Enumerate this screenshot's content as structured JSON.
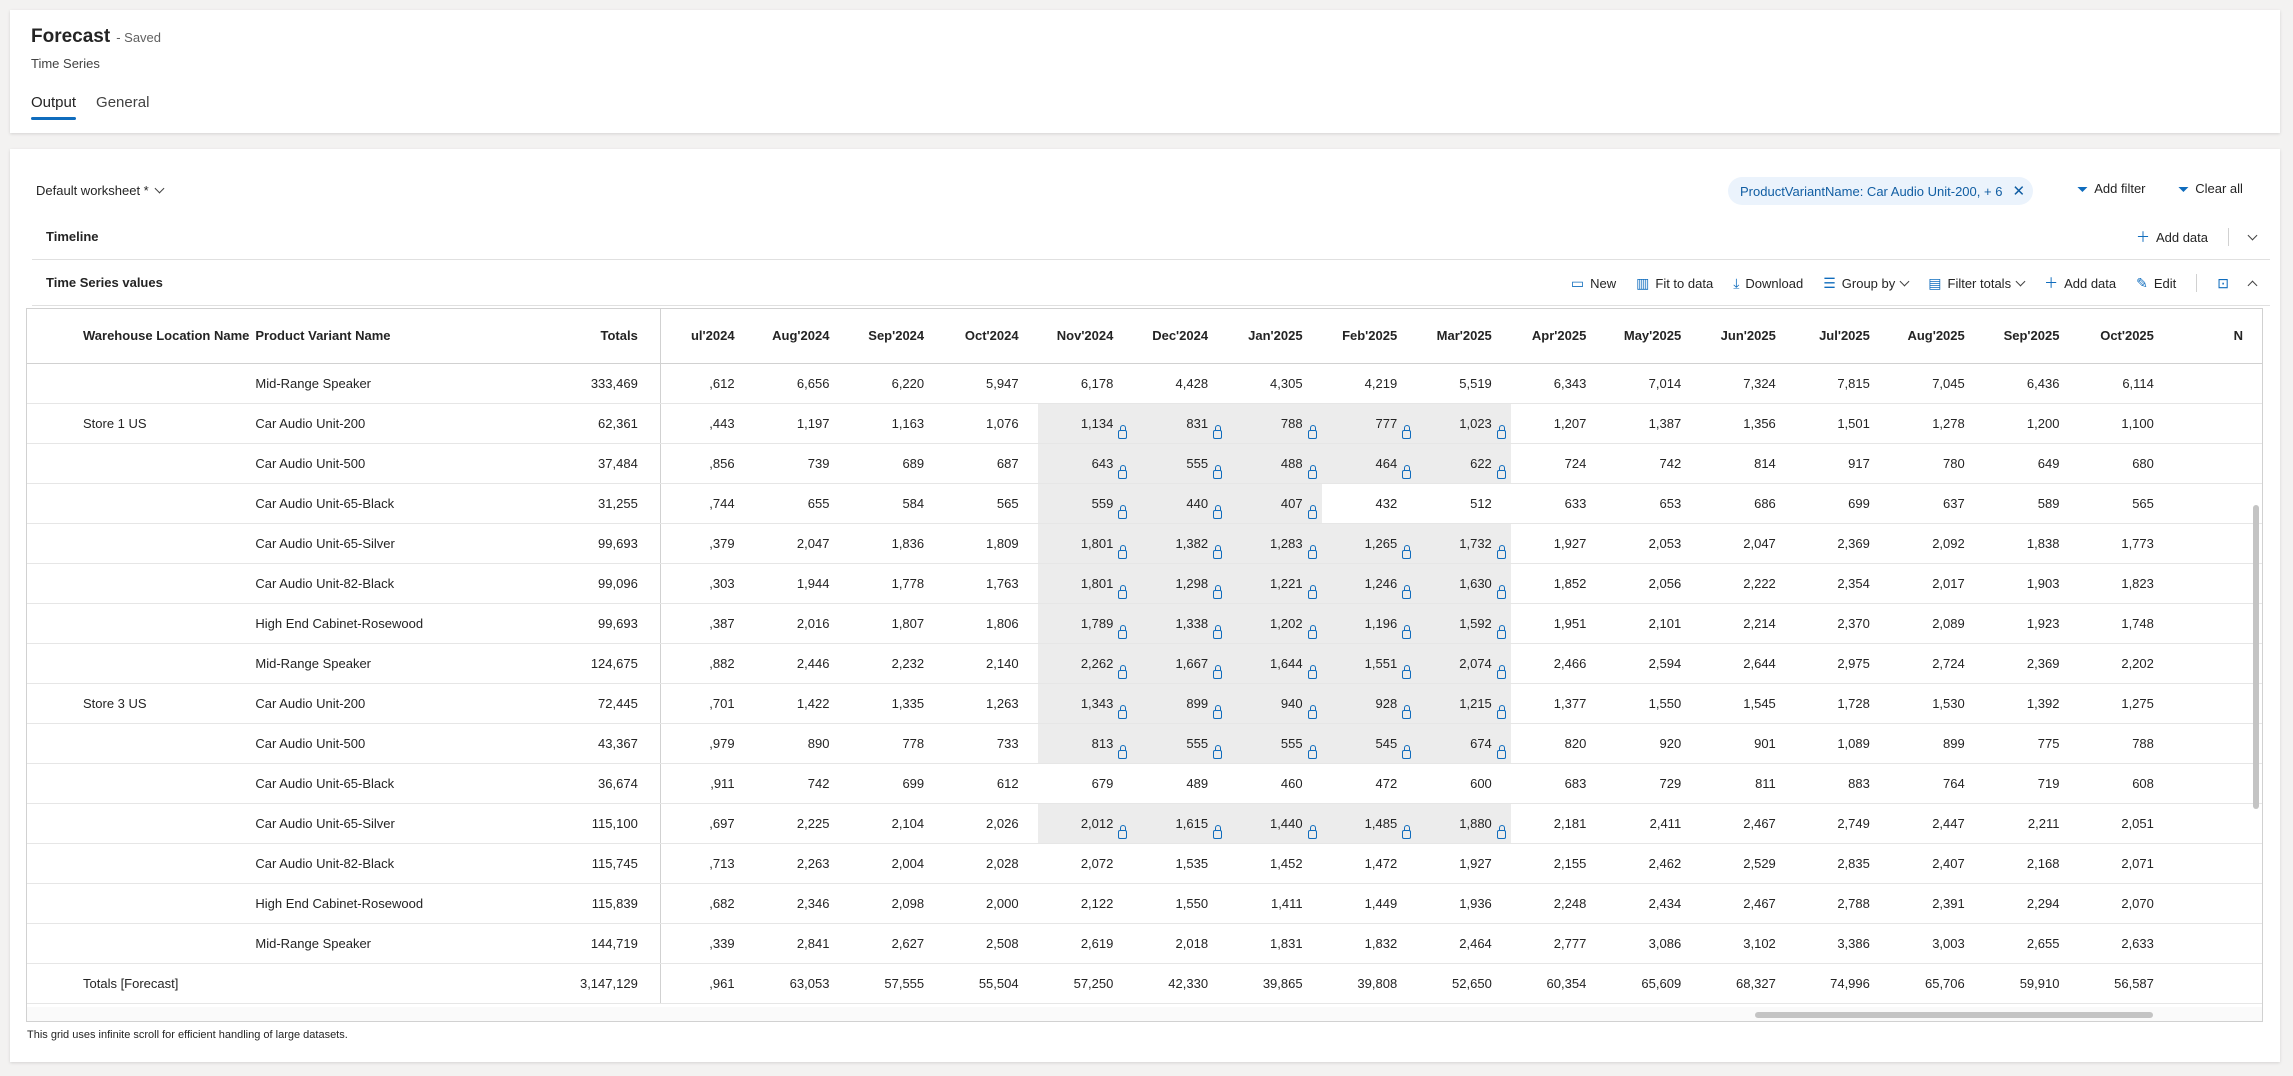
{
  "header": {
    "title": "Forecast",
    "saved": "- Saved",
    "subtitle": "Time Series"
  },
  "tabs": [
    {
      "label": "Output"
    },
    {
      "label": "General"
    }
  ],
  "worksheet": {
    "label": "Default worksheet *"
  },
  "filter_chip": {
    "label": "ProductVariantName: Car Audio Unit-200, + 6"
  },
  "actions": {
    "add_filter": "Add filter",
    "clear_all": "Clear all"
  },
  "timeline": {
    "title": "Timeline",
    "add_data": "Add data"
  },
  "tsv": {
    "title": "Time Series values",
    "toolbar": {
      "new": "New",
      "fit": "Fit to data",
      "download": "Download",
      "group_by": "Group by",
      "filter_totals": "Filter totals",
      "add_data": "Add data",
      "edit": "Edit"
    }
  },
  "grid": {
    "columns": {
      "warehouse": "Warehouse Location Name",
      "product": "Product Variant Name",
      "totals": "Totals"
    },
    "months": [
      "ul'2024",
      "Aug'2024",
      "Sep'2024",
      "Oct'2024",
      "Nov'2024",
      "Dec'2024",
      "Jan'2025",
      "Feb'2025",
      "Mar'2025",
      "Apr'2025",
      "May'2025",
      "Jun'2025",
      "Jul'2025",
      "Aug'2025",
      "Sep'2025",
      "Oct'2025",
      "N"
    ],
    "rows": [
      {
        "warehouse": "",
        "product": "Mid-Range Speaker",
        "total": "333,469",
        "values": [
          ",612",
          "6,656",
          "6,220",
          "5,947",
          "6,178",
          "4,428",
          "4,305",
          "4,219",
          "5,519",
          "6,343",
          "7,014",
          "7,324",
          "7,815",
          "7,045",
          "6,436",
          "6,114",
          ""
        ]
      },
      {
        "warehouse": "Store 1 US",
        "product": "Car Audio Unit-200",
        "total": "62,361",
        "values": [
          ",443",
          "1,197",
          "1,163",
          "1,076",
          "1,134",
          "831",
          "788",
          "777",
          "1,023",
          "1,207",
          "1,387",
          "1,356",
          "1,501",
          "1,278",
          "1,200",
          "1,100",
          ""
        ]
      },
      {
        "warehouse": "",
        "product": "Car Audio Unit-500",
        "total": "37,484",
        "values": [
          ",856",
          "739",
          "689",
          "687",
          "643",
          "555",
          "488",
          "464",
          "622",
          "724",
          "742",
          "814",
          "917",
          "780",
          "649",
          "680",
          ""
        ]
      },
      {
        "warehouse": "",
        "product": "Car Audio Unit-65-Black",
        "total": "31,255",
        "values": [
          ",744",
          "655",
          "584",
          "565",
          "559",
          "440",
          "407",
          "432",
          "512",
          "633",
          "653",
          "686",
          "699",
          "637",
          "589",
          "565",
          ""
        ]
      },
      {
        "warehouse": "",
        "product": "Car Audio Unit-65-Silver",
        "total": "99,693",
        "values": [
          ",379",
          "2,047",
          "1,836",
          "1,809",
          "1,801",
          "1,382",
          "1,283",
          "1,265",
          "1,732",
          "1,927",
          "2,053",
          "2,047",
          "2,369",
          "2,092",
          "1,838",
          "1,773",
          ""
        ]
      },
      {
        "warehouse": "",
        "product": "Car Audio Unit-82-Black",
        "total": "99,096",
        "values": [
          ",303",
          "1,944",
          "1,778",
          "1,763",
          "1,801",
          "1,298",
          "1,221",
          "1,246",
          "1,630",
          "1,852",
          "2,056",
          "2,222",
          "2,354",
          "2,017",
          "1,903",
          "1,823",
          ""
        ]
      },
      {
        "warehouse": "",
        "product": "High End Cabinet-Rosewood",
        "total": "99,693",
        "values": [
          ",387",
          "2,016",
          "1,807",
          "1,806",
          "1,789",
          "1,338",
          "1,202",
          "1,196",
          "1,592",
          "1,951",
          "2,101",
          "2,214",
          "2,370",
          "2,089",
          "1,923",
          "1,748",
          ""
        ]
      },
      {
        "warehouse": "",
        "product": "Mid-Range Speaker",
        "total": "124,675",
        "values": [
          ",882",
          "2,446",
          "2,232",
          "2,140",
          "2,262",
          "1,667",
          "1,644",
          "1,551",
          "2,074",
          "2,466",
          "2,594",
          "2,644",
          "2,975",
          "2,724",
          "2,369",
          "2,202",
          ""
        ]
      },
      {
        "warehouse": "Store 3 US",
        "product": "Car Audio Unit-200",
        "total": "72,445",
        "values": [
          ",701",
          "1,422",
          "1,335",
          "1,263",
          "1,343",
          "899",
          "940",
          "928",
          "1,215",
          "1,377",
          "1,550",
          "1,545",
          "1,728",
          "1,530",
          "1,392",
          "1,275",
          ""
        ]
      },
      {
        "warehouse": "",
        "product": "Car Audio Unit-500",
        "total": "43,367",
        "values": [
          ",979",
          "890",
          "778",
          "733",
          "813",
          "555",
          "555",
          "545",
          "674",
          "820",
          "920",
          "901",
          "1,089",
          "899",
          "775",
          "788",
          ""
        ]
      },
      {
        "warehouse": "",
        "product": "Car Audio Unit-65-Black",
        "total": "36,674",
        "values": [
          ",911",
          "742",
          "699",
          "612",
          "679",
          "489",
          "460",
          "472",
          "600",
          "683",
          "729",
          "811",
          "883",
          "764",
          "719",
          "608",
          ""
        ]
      },
      {
        "warehouse": "",
        "product": "Car Audio Unit-65-Silver",
        "total": "115,100",
        "values": [
          ",697",
          "2,225",
          "2,104",
          "2,026",
          "2,012",
          "1,615",
          "1,440",
          "1,485",
          "1,880",
          "2,181",
          "2,411",
          "2,467",
          "2,749",
          "2,447",
          "2,211",
          "2,051",
          ""
        ]
      },
      {
        "warehouse": "",
        "product": "Car Audio Unit-82-Black",
        "total": "115,745",
        "values": [
          ",713",
          "2,263",
          "2,004",
          "2,028",
          "2,072",
          "1,535",
          "1,452",
          "1,472",
          "1,927",
          "2,155",
          "2,462",
          "2,529",
          "2,835",
          "2,407",
          "2,168",
          "2,071",
          ""
        ]
      },
      {
        "warehouse": "",
        "product": "High End Cabinet-Rosewood",
        "total": "115,839",
        "values": [
          ",682",
          "2,346",
          "2,098",
          "2,000",
          "2,122",
          "1,550",
          "1,411",
          "1,449",
          "1,936",
          "2,248",
          "2,434",
          "2,467",
          "2,788",
          "2,391",
          "2,294",
          "2,070",
          ""
        ]
      },
      {
        "warehouse": "",
        "product": "Mid-Range Speaker",
        "total": "144,719",
        "values": [
          ",339",
          "2,841",
          "2,627",
          "2,508",
          "2,619",
          "2,018",
          "1,831",
          "1,832",
          "2,464",
          "2,777",
          "3,086",
          "3,102",
          "3,386",
          "3,003",
          "2,655",
          "2,633",
          ""
        ]
      }
    ],
    "totals_row": {
      "label": "Totals [Forecast]",
      "total": "3,147,129",
      "values": [
        ",961",
        "63,053",
        "57,555",
        "55,504",
        "57,250",
        "42,330",
        "39,865",
        "39,808",
        "52,650",
        "60,354",
        "65,609",
        "68,327",
        "74,996",
        "65,706",
        "59,910",
        "56,587",
        ""
      ]
    }
  },
  "note": "This grid uses infinite scroll for efficient handling of large datasets.",
  "colors": {
    "accent": "#0f6cbd",
    "locked_cell_bg": "#ececec",
    "chip_bg": "#ebf3fc"
  }
}
